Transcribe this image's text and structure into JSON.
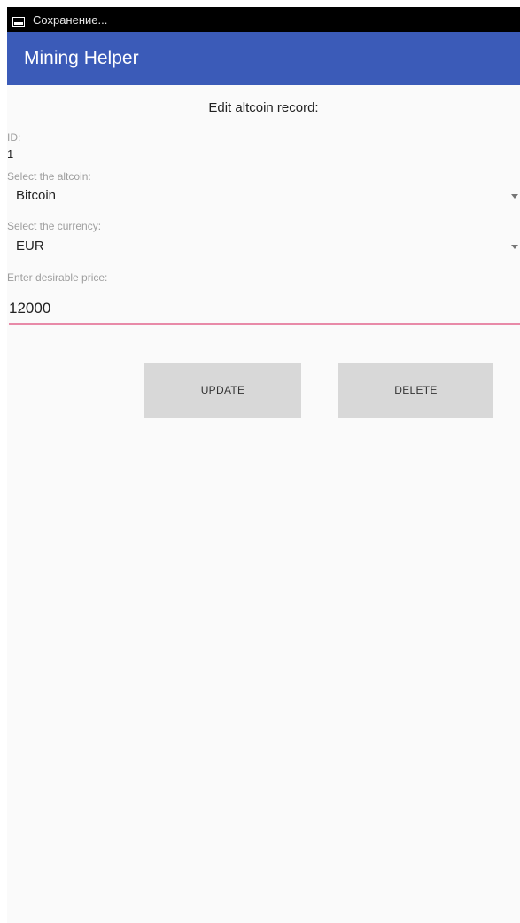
{
  "status_bar": {
    "notification_text": "Сохранение...",
    "icon": "screenshot-icon"
  },
  "app_bar": {
    "title": "Mining Helper",
    "color": "#3b5bb8"
  },
  "form": {
    "heading": "Edit altcoin record:",
    "id_label": "ID:",
    "id_value": "1",
    "altcoin_label": "Select the altcoin:",
    "altcoin_value": "Bitcoin",
    "currency_label": "Select the currency:",
    "currency_value": "EUR",
    "price_label": "Enter desirable price:",
    "price_value": "12000",
    "accent_color": "#e88aa8"
  },
  "buttons": {
    "update_label": "UPDATE",
    "delete_label": "DELETE"
  }
}
